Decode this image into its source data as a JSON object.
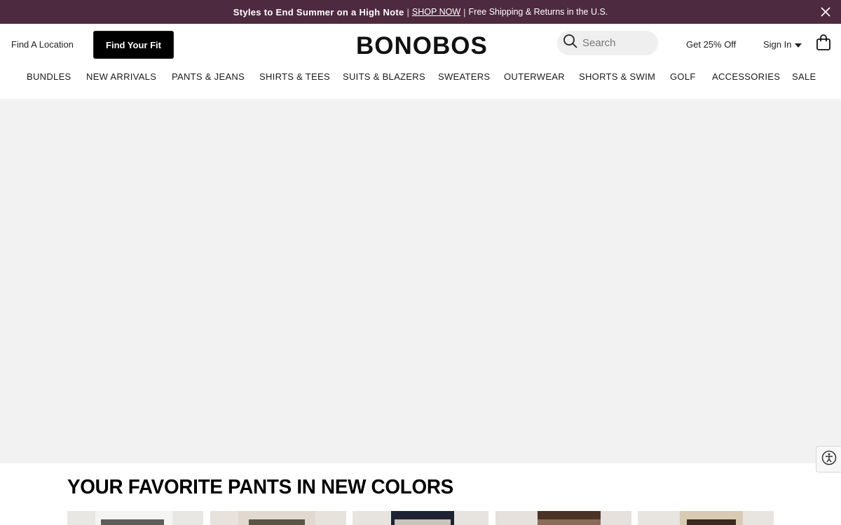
{
  "promo": {
    "headline": "Styles to End Summer on a High Note",
    "separator": "|",
    "link_label": "SHOP NOW",
    "shipping": "Free Shipping & Returns in the U.S."
  },
  "header": {
    "find_location": "Find A Location",
    "find_fit": "Find Your Fit",
    "logo": "BONOBOS",
    "search_placeholder": "Search",
    "offer": "Get 25% Off",
    "sign_in": "Sign In"
  },
  "nav": {
    "items": [
      "BUNDLES",
      "NEW ARRIVALS",
      "PANTS & JEANS",
      "SHIRTS & TEES",
      "SUITS & BLAZERS",
      "SWEATERS",
      "OUTERWEAR",
      "SHORTS & SWIM",
      "GOLF",
      "ACCESSORIES",
      "SALE"
    ]
  },
  "section": {
    "title": "YOUR FAVORITE PANTS IN NEW COLORS"
  },
  "colors": {
    "promo_bg": "#4e2a40",
    "button_bg": "#000000",
    "hero_bg": "#f2f2f2"
  }
}
